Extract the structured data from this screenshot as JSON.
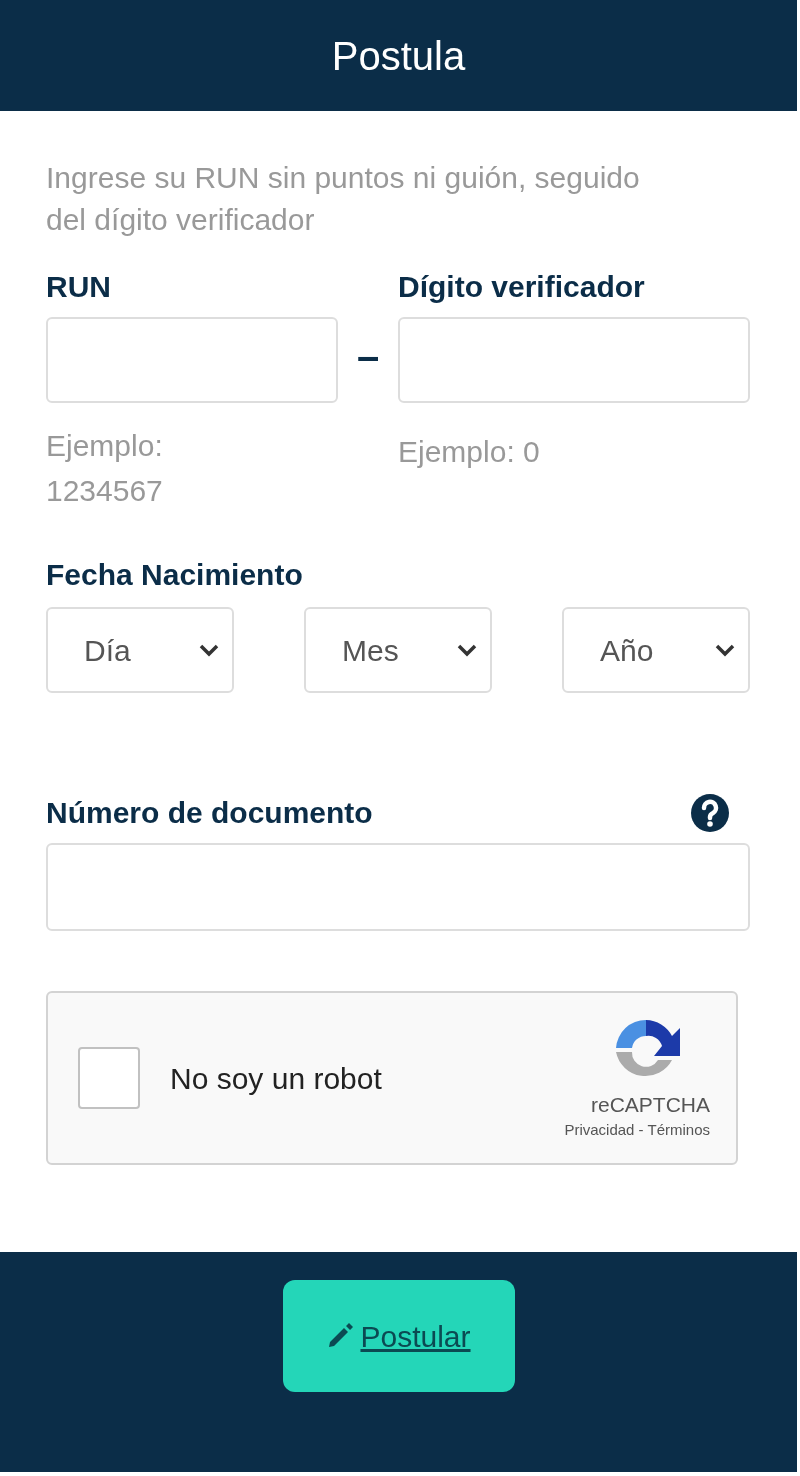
{
  "header": {
    "title": "Postula"
  },
  "instructions": "Ingrese su RUN sin puntos ni guión, seguido del dígito verificador",
  "run": {
    "label": "RUN",
    "separator": "–",
    "example": "Ejemplo: 1234567"
  },
  "dv": {
    "label": "Dígito verificador",
    "example": "Ejemplo: 0"
  },
  "birth_date": {
    "label": "Fecha Nacimiento",
    "selects": [
      {
        "placeholder": "Día"
      },
      {
        "placeholder": "Mes"
      },
      {
        "placeholder": "Año"
      }
    ]
  },
  "document": {
    "label": "Número de documento"
  },
  "captcha": {
    "label": "No soy un robot",
    "checked": false,
    "brand": "reCAPTCHA",
    "links": "Privacidad - Términos"
  },
  "submit": {
    "label": "Postular"
  }
}
